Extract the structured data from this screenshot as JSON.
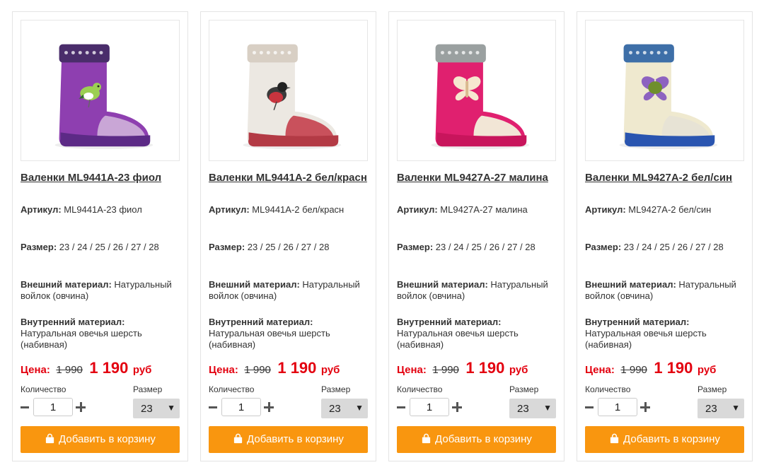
{
  "labels": {
    "article": "Артикул:",
    "size": "Размер:",
    "outer_material": "Внешний материал:",
    "inner_material": "Внутренний материал:",
    "price": "Цена:",
    "currency": "руб",
    "quantity": "Количество",
    "size_select": "Размер",
    "add_to_cart": "Добавить в корзину"
  },
  "colors": {
    "accent_orange": "#f9960f",
    "price_red": "#e3000f"
  },
  "products": [
    {
      "title": "Валенки ML9441А-23 фиол",
      "article": "ML9441A-23 фиол",
      "sizes": "23 / 24 / 25 / 26 / 27 / 28",
      "outer_material": "Натуральный войлок (овчина)",
      "inner_material": "Натуральная овечья шерсть (набивная)",
      "old_price": "1 990",
      "new_price": "1 190",
      "quantity": "1",
      "selected_size": "23",
      "image_icon": "felt-boot-purple-bird",
      "boot_color": "#8e3fb0",
      "boot_toe": "#c9a6d6",
      "boot_sole": "#5c2a86",
      "cuff_color": "#4a2d6b"
    },
    {
      "title": "Валенки ML9441А-2 бел/красн",
      "article": "ML9441A-2 бел/красн",
      "sizes": "23 / 25 / 26 / 27 / 28",
      "outer_material": "Натуральный войлок (овчина)",
      "inner_material": "Натуральная овечья шерсть (набивная)",
      "old_price": "1 990",
      "new_price": "1 190",
      "quantity": "1",
      "selected_size": "23",
      "image_icon": "felt-boot-white-bullfinch",
      "boot_color": "#ece8e2",
      "boot_toe": "#c9515c",
      "boot_sole": "#b33a45",
      "cuff_color": "#d8cfc4"
    },
    {
      "title": "Валенки ML9427А-27 малина",
      "article": "ML9427A-27 малина",
      "sizes": "23 / 24 / 25 / 26 / 27 / 28",
      "outer_material": "Натуральный войлок (овчина)",
      "inner_material": "Натуральная овечья шерсть (набивная)",
      "old_price": "1 990",
      "new_price": "1 190",
      "quantity": "1",
      "selected_size": "23",
      "image_icon": "felt-boot-raspberry-butterfly",
      "boot_color": "#e0206f",
      "boot_toe": "#f2e6d6",
      "boot_sole": "#c8155c",
      "cuff_color": "#9aa0a0"
    },
    {
      "title": "Валенки ML9427А-2 бел/син",
      "article": "ML9427A-2 бел/син",
      "sizes": "23 / 24 / 25 / 26 / 27 / 28",
      "outer_material": "Натуральный войлок (овчина)",
      "inner_material": "Натуральная овечья шерсть (набивная)",
      "old_price": "1 990",
      "new_price": "1 190",
      "quantity": "1",
      "selected_size": "23",
      "image_icon": "felt-boot-white-blue-butterfly",
      "boot_color": "#efe9cf",
      "boot_toe": "#e7e3d5",
      "boot_sole": "#2a55b0",
      "cuff_color": "#3e6fa8"
    }
  ]
}
